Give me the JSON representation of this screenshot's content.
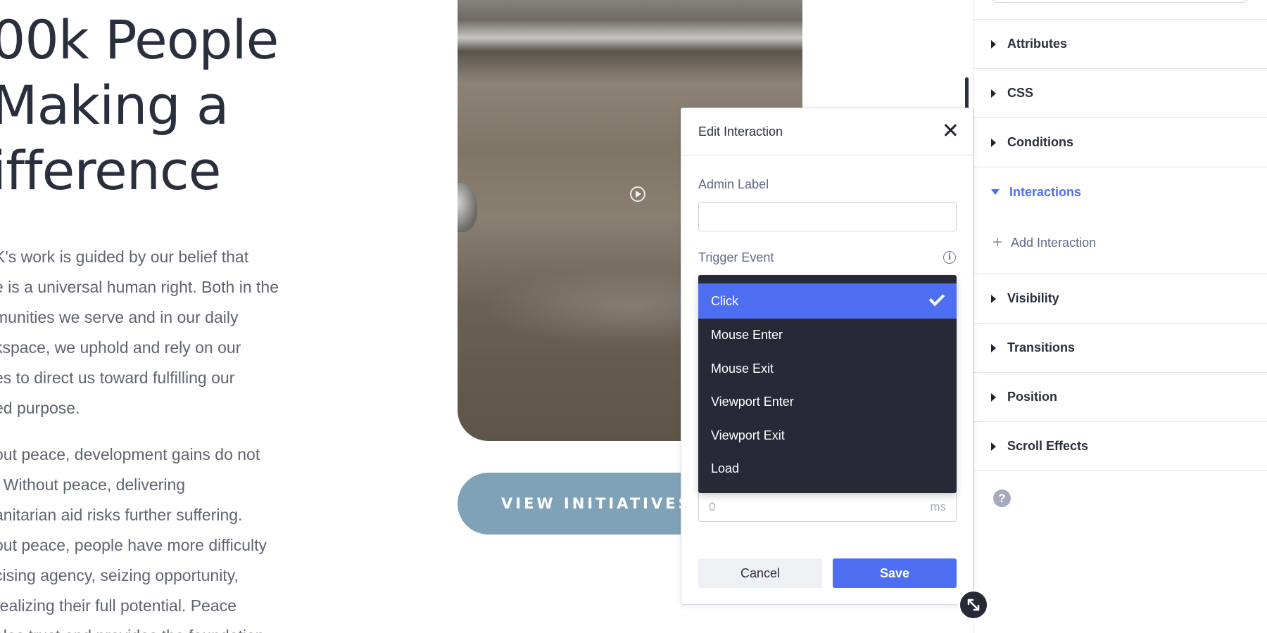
{
  "page": {
    "headline": [
      "00k People",
      "Making a",
      "ifference"
    ],
    "paragraph1": [
      "K's work is guided by our belief that",
      "e is a universal human right. Both in the",
      "munities we serve and in our daily",
      "kspace, we uphold and rely on our",
      "es to direct us toward fulfilling our",
      "ed purpose."
    ],
    "paragraph2": [
      "out peace, development gains do not",
      ". Without peace, delivering",
      "anitarian aid risks further suffering.",
      "out peace, people have more difficulty",
      "cising agency, seizing opportunity,",
      "realizing their full potential. Peace",
      "ales trust and provides the foundation"
    ],
    "view_button_label": "VIEW INITIATIVES →"
  },
  "right_panel": {
    "sections_before": [
      {
        "label": "Attributes",
        "icon": "caret-right-icon"
      },
      {
        "label": "CSS",
        "icon": "caret-right-icon"
      },
      {
        "label": "Conditions",
        "icon": "caret-right-icon"
      }
    ],
    "open_section": {
      "label": "Interactions",
      "icon": "caret-down-icon"
    },
    "add_interaction_label": "Add Interaction",
    "sections_after": [
      {
        "label": "Visibility",
        "icon": "caret-right-icon"
      },
      {
        "label": "Transitions",
        "icon": "caret-right-icon"
      },
      {
        "label": "Position",
        "icon": "caret-right-icon"
      },
      {
        "label": "Scroll Effects",
        "icon": "caret-right-icon"
      }
    ],
    "help_icon_text": "?"
  },
  "modal": {
    "title": "Edit Interaction",
    "admin_label_label": "Admin Label",
    "admin_label_value": "",
    "trigger_event_label": "Trigger Event",
    "trigger_options": [
      "Click",
      "Mouse Enter",
      "Mouse Exit",
      "Viewport Enter",
      "Viewport Exit",
      "Load"
    ],
    "selected_trigger": "Click",
    "delay_value": "0",
    "delay_unit": "ms",
    "cancel_label": "Cancel",
    "save_label": "Save"
  },
  "colors": {
    "accent": "#4e6ef2",
    "dropdown_bg": "#272a36",
    "button_blue_grey": "#80a2b8"
  }
}
